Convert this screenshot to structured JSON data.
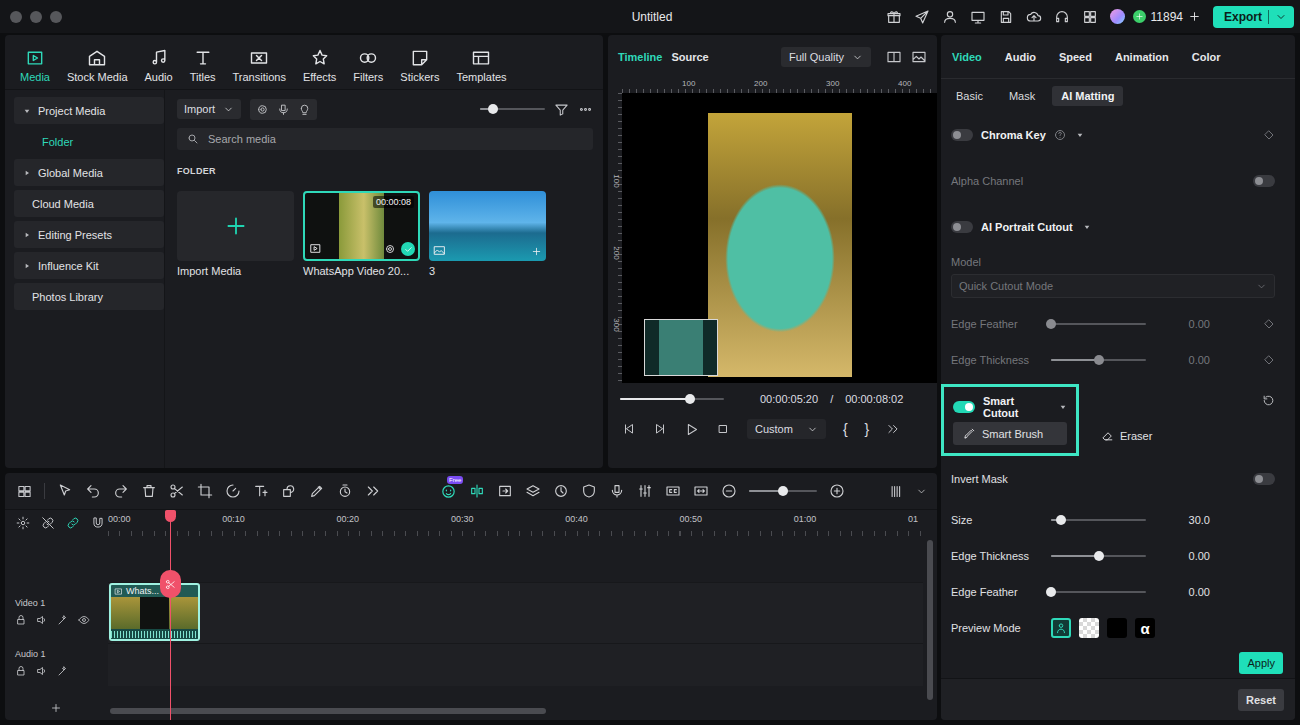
{
  "window": {
    "title": "Untitled"
  },
  "account": {
    "credits": "11894"
  },
  "export": {
    "label": "Export"
  },
  "media_tabs": [
    {
      "label": "Media",
      "selected": true
    },
    {
      "label": "Stock Media",
      "selected": false
    },
    {
      "label": "Audio",
      "selected": false
    },
    {
      "label": "Titles",
      "selected": false
    },
    {
      "label": "Transitions",
      "selected": false
    },
    {
      "label": "Effects",
      "selected": false
    },
    {
      "label": "Filters",
      "selected": false
    },
    {
      "label": "Stickers",
      "selected": false
    },
    {
      "label": "Templates",
      "selected": false
    }
  ],
  "sidebar": [
    {
      "label": "Project Media",
      "kind": "group",
      "expanded": true,
      "selected": false
    },
    {
      "label": "Folder",
      "kind": "child",
      "expanded": false,
      "selected": true
    },
    {
      "label": "Global Media",
      "kind": "group",
      "expanded": false,
      "selected": false
    },
    {
      "label": "Cloud Media",
      "kind": "item",
      "expanded": false,
      "selected": false
    },
    {
      "label": "Editing Presets",
      "kind": "group",
      "expanded": false,
      "selected": false
    },
    {
      "label": "Influence Kit",
      "kind": "group",
      "expanded": false,
      "selected": false
    },
    {
      "label": "Photos Library",
      "kind": "item",
      "expanded": false,
      "selected": false
    }
  ],
  "media_toolbar": {
    "import": "Import",
    "zoom": 0.2,
    "search_placeholder": "Search media"
  },
  "folder": {
    "heading": "FOLDER",
    "cards": [
      {
        "kind": "import",
        "label": "Import Media",
        "duration": "",
        "selected": false
      },
      {
        "kind": "video",
        "label": "WhatsApp Video 20...",
        "duration": "00:00:08",
        "selected": true
      },
      {
        "kind": "image",
        "label": "3",
        "duration": "",
        "selected": false
      }
    ]
  },
  "preview": {
    "tabs": [
      {
        "label": "Timeline",
        "selected": true
      },
      {
        "label": "Source",
        "selected": false
      }
    ],
    "quality": "Full Quality",
    "ruler_h": [
      "100",
      "200",
      "300",
      "400"
    ],
    "ruler_v": [
      "100",
      "200",
      "300"
    ],
    "progress": 0.67,
    "current": "00:00:05:20",
    "separator": "/",
    "total": "00:00:08:02",
    "zoom": "Custom",
    "mark_in": "{",
    "mark_out": "}"
  },
  "properties": {
    "tabs": [
      {
        "label": "Video",
        "selected": true
      },
      {
        "label": "Audio",
        "selected": false
      },
      {
        "label": "Speed",
        "selected": false
      },
      {
        "label": "Animation",
        "selected": false
      },
      {
        "label": "Color",
        "selected": false
      }
    ],
    "subtabs": [
      {
        "label": "Basic",
        "selected": false
      },
      {
        "label": "Mask",
        "selected": false
      },
      {
        "label": "AI Matting",
        "selected": true
      }
    ],
    "rows": [
      {
        "kind": "section",
        "label": "Chroma Key",
        "on": false,
        "help": true,
        "keyframe": true
      },
      {
        "kind": "toggle",
        "label": "Alpha Channel",
        "on": false,
        "disabled": true
      },
      {
        "kind": "section",
        "label": "AI Portrait Cutout",
        "on": false,
        "help": false,
        "keyframe": false
      },
      {
        "kind": "label",
        "label": "Model",
        "disabled": true
      },
      {
        "kind": "select",
        "value": "Quick Cutout Mode",
        "disabled": true
      },
      {
        "kind": "slider",
        "label": "Edge Feather",
        "level": 0,
        "reading": "0.00",
        "disabled": true,
        "keyframe": true
      },
      {
        "kind": "slider",
        "label": "Edge Thickness",
        "level": 0.5,
        "reading": "0.00",
        "disabled": true,
        "keyframe": true
      },
      {
        "kind": "smart",
        "label": "Smart Cutout",
        "on": true,
        "highlighted": true,
        "tools": [
          {
            "label": "Smart Brush",
            "selected": true
          },
          {
            "label": "Eraser",
            "selected": false
          }
        ]
      },
      {
        "kind": "toggle",
        "label": "Invert Mask",
        "on": false,
        "disabled": false
      },
      {
        "kind": "slider",
        "label": "Size",
        "level": 0.1,
        "reading": "30.0",
        "disabled": false,
        "keyframe": false
      },
      {
        "kind": "slider",
        "label": "Edge Thickness",
        "level": 0.5,
        "reading": "0.00",
        "disabled": false,
        "keyframe": false
      },
      {
        "kind": "slider",
        "label": "Edge Feather",
        "level": 0,
        "reading": "0.00",
        "disabled": false,
        "keyframe": false
      },
      {
        "kind": "swatches",
        "label": "Preview Mode",
        "options": [
          {
            "kind": "person",
            "label": "",
            "selected": true
          },
          {
            "kind": "checker",
            "label": "",
            "selected": false
          },
          {
            "kind": "black",
            "label": "",
            "selected": false
          },
          {
            "kind": "alpha",
            "label": "α",
            "selected": false
          }
        ]
      }
    ],
    "apply": "Apply",
    "reset": "Reset"
  },
  "timeline": {
    "badge": "Free",
    "zoom": 0.5,
    "ruler": [
      "00:00",
      "00:10",
      "00:20",
      "00:30",
      "00:40",
      "00:50",
      "01:00",
      "01"
    ],
    "tracks": [
      {
        "label": "Video 1",
        "kind": "video"
      },
      {
        "label": "Audio 1",
        "kind": "audio"
      }
    ],
    "clip": {
      "label": "Whats...",
      "seconds": 8,
      "selected": true
    }
  }
}
